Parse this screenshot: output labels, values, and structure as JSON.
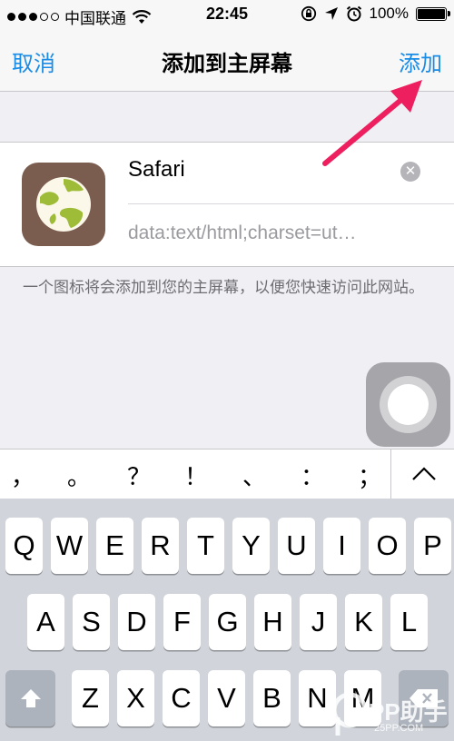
{
  "status_bar": {
    "carrier": "中国联通",
    "time": "22:45",
    "battery": "100%",
    "battery_level": 1.0,
    "signal_dots_filled": 3,
    "signal_dots_total": 5
  },
  "nav": {
    "cancel_label": "取消",
    "title": "添加到主屏幕",
    "add_label": "添加"
  },
  "bookmark": {
    "name": "Safari",
    "clear_glyph": "✕",
    "url": "data:text/html;charset=ut…"
  },
  "note": "一个图标将会添加到您的主屏幕，以便您快速访问此网站。",
  "punctuation": [
    "，",
    "。",
    "？",
    "！",
    "、",
    "：",
    "；"
  ],
  "keyboard": {
    "row1": [
      "Q",
      "W",
      "E",
      "R",
      "T",
      "Y",
      "U",
      "I",
      "O",
      "P"
    ],
    "row2": [
      "A",
      "S",
      "D",
      "F",
      "G",
      "H",
      "J",
      "K",
      "L"
    ],
    "row3": [
      "Z",
      "X",
      "C",
      "V",
      "B",
      "N",
      "M"
    ]
  },
  "watermark": {
    "text": "PP助手",
    "sub": "25PP.COM"
  },
  "colors": {
    "accent": "#1a8ce6",
    "arrow": "#ee1f5e",
    "icon_bg": "#7b5d50"
  },
  "icons": {
    "wifi": "wifi-icon",
    "rotation_lock": "rotation-lock-icon",
    "location": "location-arrow-icon",
    "alarm": "alarm-clock-icon",
    "shift": "shift-arrow-icon",
    "delete": "backspace-icon",
    "expand": "chevron-up-icon",
    "assistive": "assistive-touch-icon",
    "app": "globe-icon"
  }
}
